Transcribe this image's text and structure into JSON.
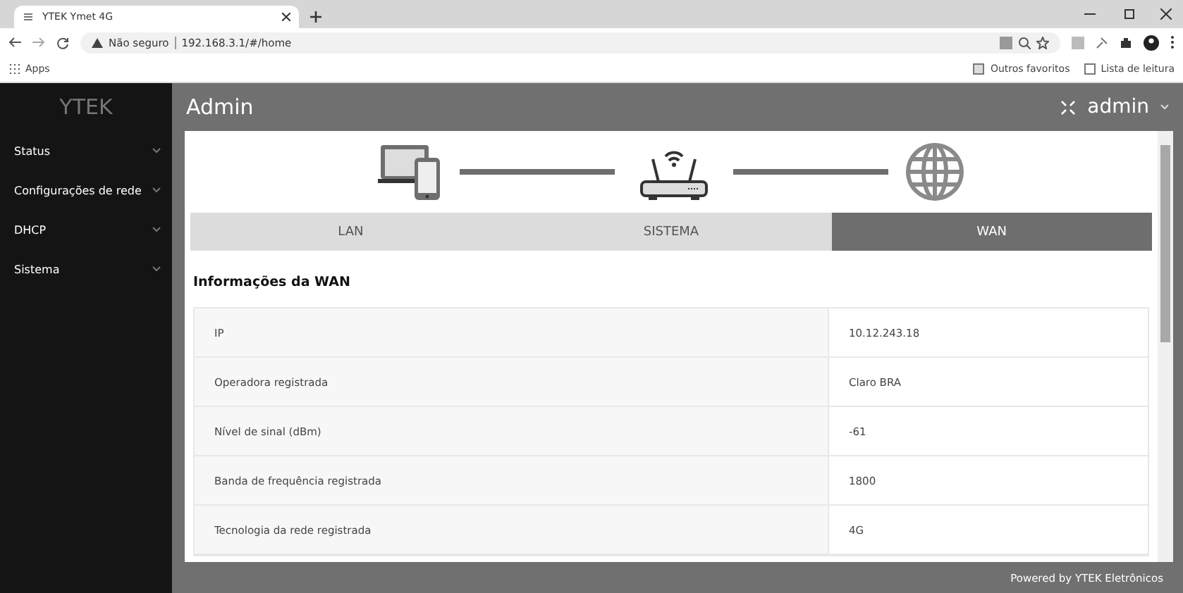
{
  "browser": {
    "tab_title": "YTEK Ymet 4G",
    "security": "Não seguro",
    "url": "192.168.3.1/#/home",
    "bookmarks": [
      "Apps"
    ],
    "bookmarks_right": [
      "Outros favoritos",
      "Lista de leitura"
    ]
  },
  "sidebar": {
    "logo": "YTEK",
    "items": [
      {
        "label": "Status",
        "expanded": false
      },
      {
        "label": "Configurações de rede",
        "expanded": false
      },
      {
        "label": "DHCP",
        "expanded": false
      },
      {
        "label": "Sistema",
        "expanded": false
      }
    ]
  },
  "header": {
    "title": "Admin",
    "user": "admin"
  },
  "tabs": [
    {
      "label": "LAN",
      "selected": false
    },
    {
      "label": "SISTEMA",
      "selected": false
    },
    {
      "label": "WAN",
      "selected": true
    }
  ],
  "section_title": "Informações da WAN",
  "rows": [
    {
      "label": "IP",
      "value": "10.12.243.18"
    },
    {
      "label": "Operadora registrada",
      "value": "Claro BRA"
    },
    {
      "label": "Nível de sinal (dBm)",
      "value": "-61"
    },
    {
      "label": "Banda de frequência registrada",
      "value": "1800"
    },
    {
      "label": "Tecnologia da rede registrada",
      "value": "4G"
    }
  ],
  "footer": "Powered by YTEK Eletrônicos"
}
